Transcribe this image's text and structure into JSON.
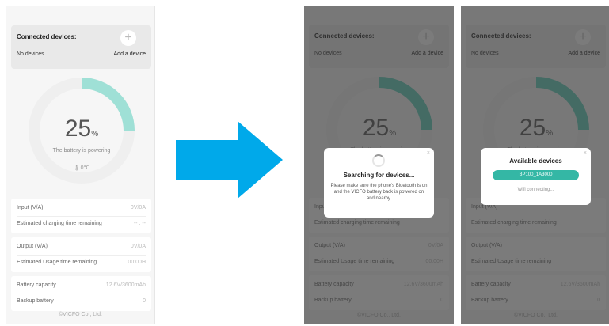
{
  "connected": {
    "title": "Connected devices:",
    "none": "No devices",
    "add": "Add a device",
    "plus": "+"
  },
  "battery": {
    "percent_value": "25",
    "percent_sign": "%",
    "level_fraction": 0.25,
    "status": "The battery is powering",
    "temperature": "0℃"
  },
  "input_card": {
    "input_label": "Input (V/A)",
    "input_value": "0V/0A",
    "charge_time_label": "Estimated charging time remaining",
    "charge_time_value": "-- : --"
  },
  "output_card": {
    "output_label": "Output (V/A)",
    "output_value": "0V/0A",
    "usage_time_label": "Estimated Usage time remaining",
    "usage_time_value": "00:00H"
  },
  "capacity_card": {
    "capacity_label": "Battery capacity",
    "capacity_value": "12.6V/3600mAh",
    "backup_label": "Backup battery",
    "backup_value": "0"
  },
  "footer": "©VICFO Co., Ltd.",
  "searching_dialog": {
    "close": "×",
    "title": "Searching for devices...",
    "message": "Please make sure the phone's Bluetooth is on and the VICFO battery back is powered on and nearby."
  },
  "available_dialog": {
    "close": "×",
    "title": "Available devices",
    "device": "BP100_1A3000",
    "connecting": "Wifi connecting..."
  },
  "colors": {
    "accent": "#34b7a5",
    "arrow": "#00a9ea",
    "overlay": "#373737"
  },
  "icons": {
    "thermometer": "thermometer-icon",
    "add": "plus-icon",
    "arrow": "arrow-right-icon",
    "spinner": "loading-spinner-icon"
  }
}
